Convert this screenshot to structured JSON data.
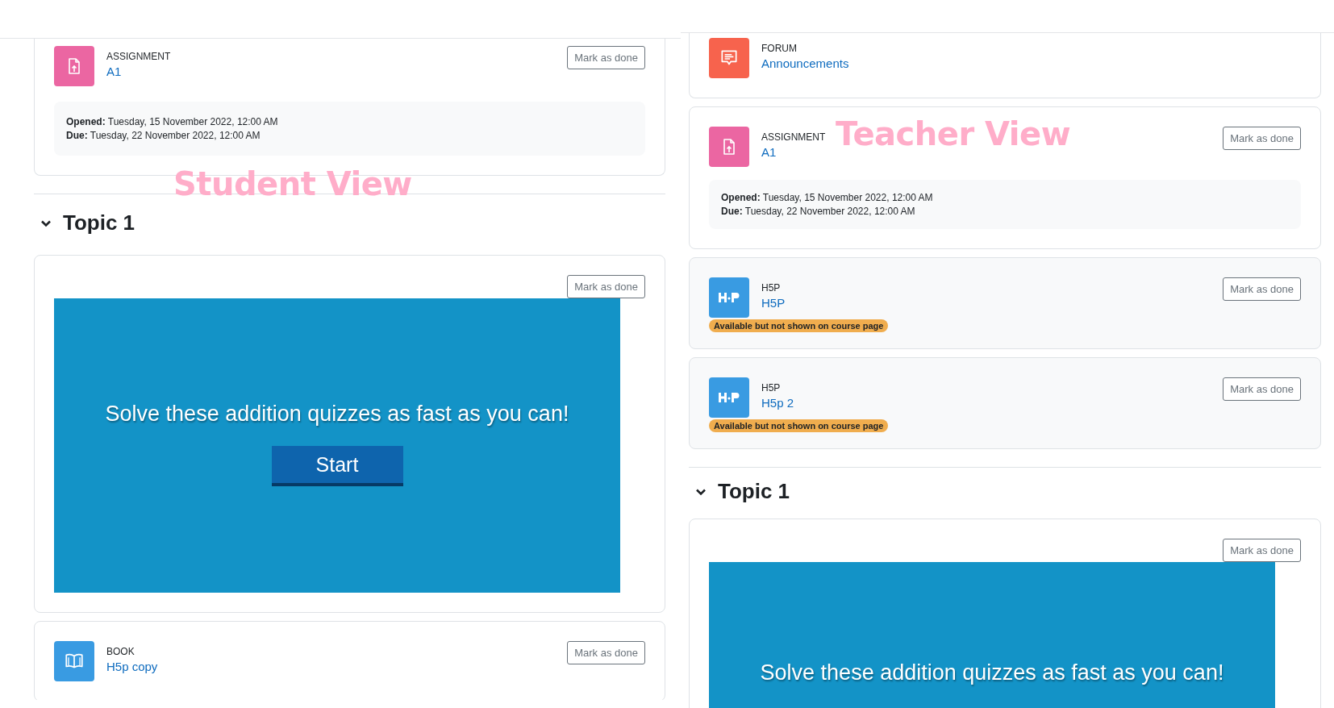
{
  "views": [
    {
      "label": "Student View",
      "blocks": [
        {
          "kind": "assign",
          "type_label": "ASSIGNMENT",
          "name": "A1",
          "button": "Mark as done",
          "dates": [
            "**Opened:** Tuesday, 15 November 2022, 12:00 AM",
            "**Due:** Tuesday, 22 November 2022, 12:00 AM"
          ]
        },
        {
          "kind": "section",
          "title": "Topic 1",
          "expanded": true
        },
        {
          "kind": "embed",
          "button": "Mark as done",
          "prompt": "Solve these addition quizzes as fast as you can!",
          "start": "Start"
        },
        {
          "kind": "book",
          "type_label": "BOOK",
          "name": "H5p copy",
          "button": "Mark as done"
        }
      ]
    },
    {
      "label": "Teacher View",
      "blocks": [
        {
          "kind": "forum",
          "type_label": "FORUM",
          "name": "Announcements"
        },
        {
          "kind": "assign",
          "type_label": "ASSIGNMENT",
          "name": "A1",
          "button": "Mark as done",
          "dates": [
            "**Opened:** Tuesday, 15 November 2022, 12:00 AM",
            "**Due:** Tuesday, 22 November 2022, 12:00 AM"
          ]
        },
        {
          "kind": "h5p",
          "type_label": "H5P",
          "name": "H5P",
          "button": "Mark as done",
          "badge": "Available but not shown on course page"
        },
        {
          "kind": "h5p",
          "type_label": "H5P",
          "name": "H5p 2",
          "button": "Mark as done",
          "badge": "Available but not shown on course page"
        },
        {
          "kind": "section",
          "title": "Topic 1",
          "expanded": true
        },
        {
          "kind": "embed",
          "button": "Mark as done",
          "prompt": "Solve these addition quizzes as fast as you can!"
        }
      ]
    }
  ]
}
